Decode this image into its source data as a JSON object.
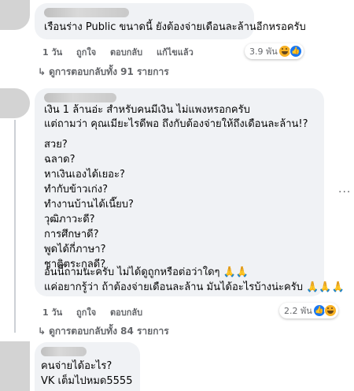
{
  "comments": [
    {
      "lines": [
        "เรือนร่าง Public ขนาดนี้ ยังต้องจ่ายเดือนละล้านอีกหรอครับ"
      ],
      "actions": {
        "time": "1 วัน",
        "like": "ถูกใจ",
        "reply": "ตอบกลับ",
        "edited": "แก้ไขแล้ว"
      },
      "reactions": {
        "count": "3.9 พัน",
        "icons": [
          "haha-emoji-icon",
          "like-reaction-icon"
        ]
      },
      "replies_link": "ดูการตอบกลับทั้ง 91 รายการ"
    },
    {
      "lines": [
        "เงิน 1 ล้านอ่ะ สำหรับคนมีเงิน ไม่แพงหรอกครับ",
        "แต่ถามว่า คุณเมียะไรดีพอ ถึงกับต้องจ่ายให้ถึงเดือนละล้าน!?",
        "",
        "สวย?",
        "ฉลาด?",
        "หาเงินเองได้เยอะ?",
        "ทำกับข้าวเก่ง?",
        "ทำงานบ้านได้เนี๊ยบ?",
        "วุฒิภาวะดี?",
        "การศึกษาดี?",
        "พูดได้กี่ภาษา?",
        "ชาติตระกูลดี?",
        "",
        "อันนี้ถามนะครับ ไม่ได้ดูถูกหรือต่อว่าใดๆ 🙏🙏",
        "แค่อยากรู้ว่า ถ้าต้องจ่ายเดือนละล้าน มันได้อะไรบ้างน่ะครับ 🙏🙏🙏"
      ],
      "actions": {
        "time": "1 วัน",
        "like": "ถูกใจ",
        "reply": "ตอบกลับ"
      },
      "reactions": {
        "count": "2.2 พัน",
        "icons": [
          "like-reaction-icon",
          "haha-emoji-icon"
        ]
      },
      "replies_link": "ดูการตอบกลับทั้ง 84 รายการ"
    },
    {
      "lines": [
        "คนจ่ายได้อะไร?",
        "VK เต็มไปหมด5555"
      ]
    }
  ],
  "more_menu": "···"
}
